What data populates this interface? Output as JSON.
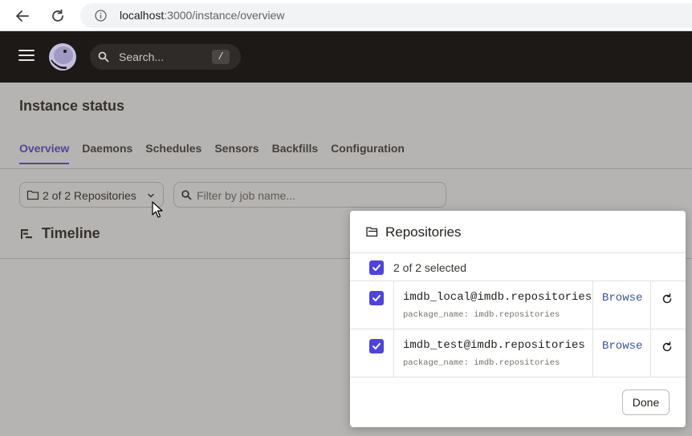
{
  "browser": {
    "url_host": "localhost",
    "url_path": ":3000/instance/overview"
  },
  "header": {
    "search_placeholder": "Search...",
    "search_shortcut": "/"
  },
  "page": {
    "title": "Instance status",
    "tabs": [
      {
        "label": "Overview",
        "active": true
      },
      {
        "label": "Daemons",
        "active": false
      },
      {
        "label": "Schedules",
        "active": false
      },
      {
        "label": "Sensors",
        "active": false
      },
      {
        "label": "Backfills",
        "active": false
      },
      {
        "label": "Configuration",
        "active": false
      }
    ],
    "repo_filter_label": "2 of 2 Repositories",
    "job_filter_placeholder": "Filter by job name...",
    "timeline_heading": "Timeline"
  },
  "dialog": {
    "title": "Repositories",
    "select_all_label": "2 of 2 selected",
    "select_all_checked": true,
    "repositories": [
      {
        "name": "imdb_local@imdb.repositories",
        "package": "package_name: imdb.repositories",
        "checked": true,
        "browse_label": "Browse"
      },
      {
        "name": "imdb_test@imdb.repositories",
        "package": "package_name: imdb.repositories",
        "checked": true,
        "browse_label": "Browse"
      }
    ],
    "done_label": "Done"
  },
  "colors": {
    "accent": "#4f43dd",
    "header_bg": "#1c1917",
    "link": "#3a5598"
  }
}
